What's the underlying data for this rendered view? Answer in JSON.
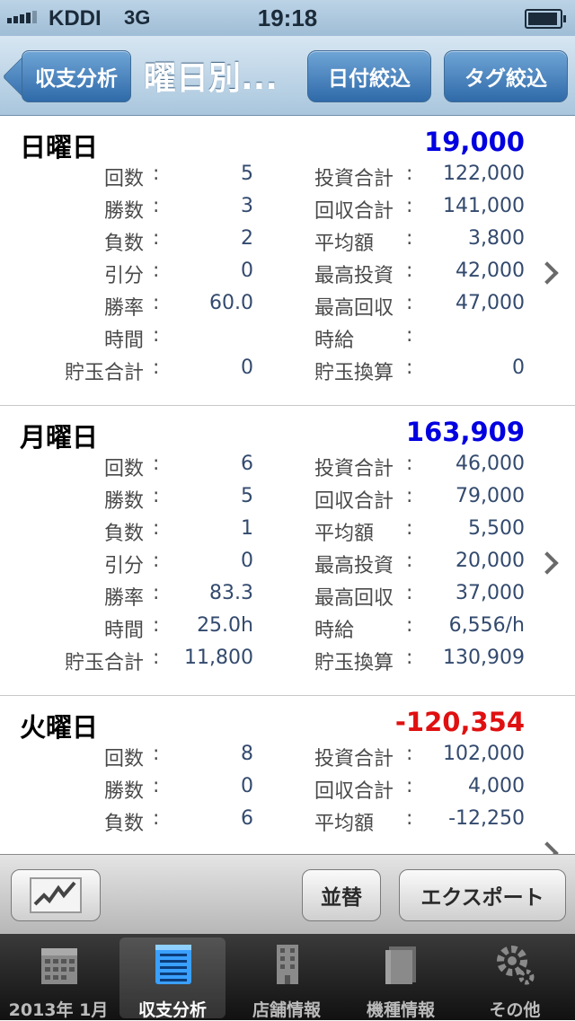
{
  "status": {
    "carrier": "KDDI",
    "network": "3G",
    "time": "19:18"
  },
  "nav": {
    "back_label": "収支分析",
    "title": "曜日別...",
    "date_filter_label": "日付絞込",
    "tag_filter_label": "タグ絞込"
  },
  "colors": {
    "positive": "#0000e0",
    "negative": "#e01010"
  },
  "sections": [
    {
      "day": "日曜日",
      "total": "19,000",
      "total_sign": "positive",
      "rows": [
        {
          "l1": "回数",
          "v1": "5",
          "l2": "投資合計",
          "v2": "122,000"
        },
        {
          "l1": "勝数",
          "v1": "3",
          "l2": "回収合計",
          "v2": "141,000"
        },
        {
          "l1": "負数",
          "v1": "2",
          "l2": "平均額",
          "v2": "3,800"
        },
        {
          "l1": "引分",
          "v1": "0",
          "l2": "最高投資",
          "v2": "42,000"
        },
        {
          "l1": "勝率",
          "v1": "60.0",
          "l2": "最高回収",
          "v2": "47,000"
        },
        {
          "l1": "時間",
          "v1": "",
          "l2": "時給",
          "v2": ""
        },
        {
          "l1": "貯玉合計",
          "v1": "0",
          "l2": "貯玉換算",
          "v2": "0"
        }
      ]
    },
    {
      "day": "月曜日",
      "total": "163,909",
      "total_sign": "positive",
      "rows": [
        {
          "l1": "回数",
          "v1": "6",
          "l2": "投資合計",
          "v2": "46,000"
        },
        {
          "l1": "勝数",
          "v1": "5",
          "l2": "回収合計",
          "v2": "79,000"
        },
        {
          "l1": "負数",
          "v1": "1",
          "l2": "平均額",
          "v2": "5,500"
        },
        {
          "l1": "引分",
          "v1": "0",
          "l2": "最高投資",
          "v2": "20,000"
        },
        {
          "l1": "勝率",
          "v1": "83.3",
          "l2": "最高回収",
          "v2": "37,000"
        },
        {
          "l1": "時間",
          "v1": "25.0h",
          "l2": "時給",
          "v2": "6,556/h"
        },
        {
          "l1": "貯玉合計",
          "v1": "11,800",
          "l2": "貯玉換算",
          "v2": "130,909"
        }
      ]
    },
    {
      "day": "火曜日",
      "total": "-120,354",
      "total_sign": "negative",
      "rows": [
        {
          "l1": "回数",
          "v1": "8",
          "l2": "投資合計",
          "v2": "102,000"
        },
        {
          "l1": "勝数",
          "v1": "0",
          "l2": "回収合計",
          "v2": "4,000"
        },
        {
          "l1": "負数",
          "v1": "6",
          "l2": "平均額",
          "v2": "-12,250"
        }
      ]
    }
  ],
  "toolbar": {
    "sort_label": "並替",
    "export_label": "エクスポート"
  },
  "tabs": [
    {
      "label": "2013年 1月",
      "icon": "calendar-icon",
      "active": false
    },
    {
      "label": "収支分析",
      "icon": "notepad-icon",
      "active": true
    },
    {
      "label": "店舗情報",
      "icon": "building-icon",
      "active": false
    },
    {
      "label": "機種情報",
      "icon": "books-icon",
      "active": false
    },
    {
      "label": "その他",
      "icon": "gear-icon",
      "active": false
    }
  ]
}
